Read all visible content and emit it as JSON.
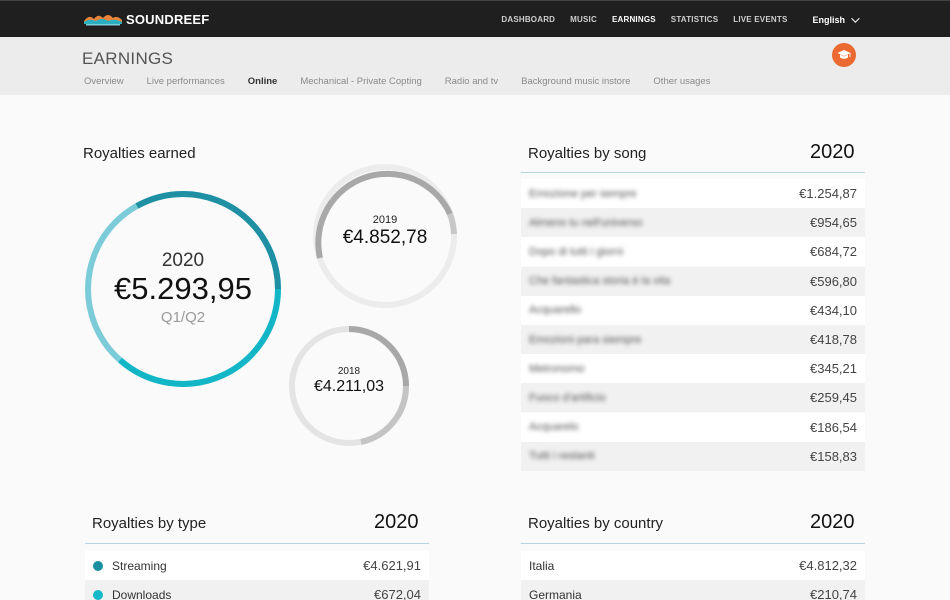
{
  "app": {
    "brand": "SOUNDREEF",
    "nav": [
      {
        "label": "DASHBOARD",
        "active": false
      },
      {
        "label": "MUSIC",
        "active": false
      },
      {
        "label": "EARNINGS",
        "active": true
      },
      {
        "label": "STATISTICS",
        "active": false
      },
      {
        "label": "LIVE EVENTS",
        "active": false
      }
    ],
    "language": "English"
  },
  "page": {
    "title": "EARNINGS",
    "tabs": [
      {
        "label": "Overview",
        "active": false
      },
      {
        "label": "Live performances",
        "active": false
      },
      {
        "label": "Online",
        "active": true
      },
      {
        "label": "Mechanical - Private Copting",
        "active": false
      },
      {
        "label": "Radio and tv",
        "active": false
      },
      {
        "label": "Background music instore",
        "active": false
      },
      {
        "label": "Other usages",
        "active": false
      }
    ],
    "help_icon": "graduation-cap-icon"
  },
  "royalties_earned": {
    "heading": "Royalties earned",
    "main": {
      "year": "2020",
      "amount": "€5.293,95",
      "period": "Q1/Q2"
    },
    "prev1": {
      "year": "2019",
      "amount": "€4.852,78"
    },
    "prev2": {
      "year": "2018",
      "amount": "€4.211,03"
    }
  },
  "royalties_by_song": {
    "heading": "Royalties by song",
    "year": "2020",
    "rows": [
      {
        "name": "Emozione per sempre",
        "value": "€1.254,87"
      },
      {
        "name": "Almeno tu nell'universo",
        "value": "€954,65"
      },
      {
        "name": "Dopo di tutti i giorni",
        "value": "€684,72"
      },
      {
        "name": "Che fantastica storia è la vita",
        "value": "€596,80"
      },
      {
        "name": "Acquarello",
        "value": "€434,10"
      },
      {
        "name": "Emozioni para siempre",
        "value": "€418,78"
      },
      {
        "name": "Metronomo",
        "value": "€345,21"
      },
      {
        "name": "Fuoco d'artificio",
        "value": "€259,45"
      },
      {
        "name": "Acquarelo",
        "value": "€186,54"
      },
      {
        "name": "Tutti i restanti",
        "value": "€158,83"
      }
    ]
  },
  "royalties_by_type": {
    "heading": "Royalties by type",
    "year": "2020",
    "rows": [
      {
        "name": "Streaming",
        "value": "€4.621,91",
        "color": "#1b8fa0"
      },
      {
        "name": "Downloads",
        "value": "€672,04",
        "color": "#15b8c8"
      }
    ]
  },
  "royalties_by_country": {
    "heading": "Royalties by country",
    "year": "2020",
    "rows": [
      {
        "name": "Italia",
        "value": "€4.812,32"
      },
      {
        "name": "Germania",
        "value": "€210,74"
      }
    ]
  },
  "colors": {
    "teal_dark": "#1f8fa3",
    "teal": "#12b6c6",
    "teal_light": "#7ccbd8",
    "gray_ring": "#a8a8a8",
    "gray_track": "#ececec",
    "accent": "#ea6a32"
  }
}
